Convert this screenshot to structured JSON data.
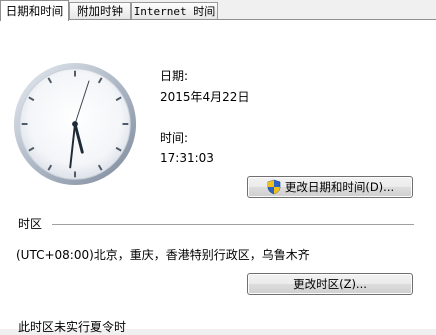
{
  "tabs": [
    {
      "label": "日期和时间"
    },
    {
      "label": "附加时钟"
    },
    {
      "label": "Internet 时间"
    }
  ],
  "date_section": {
    "date_label": "日期:",
    "date_value": "2015年4月22日",
    "time_label": "时间:",
    "time_value": "17:31:03",
    "clock": {
      "hours": 17,
      "minutes": 31,
      "seconds": 3
    }
  },
  "buttons": {
    "change_datetime": "更改日期和时间(D)...",
    "change_timezone": "更改时区(Z)..."
  },
  "timezone_section": {
    "heading": "时区",
    "value": "(UTC+08:00)北京，重庆，香港特别行政区，乌鲁木齐"
  },
  "dst_note": "此时区未实行夏令时",
  "icons": {
    "shield": "uac-shield-icon"
  },
  "colors": {
    "shield_blue": "#2a64c5",
    "shield_yellow": "#f2c01d"
  }
}
